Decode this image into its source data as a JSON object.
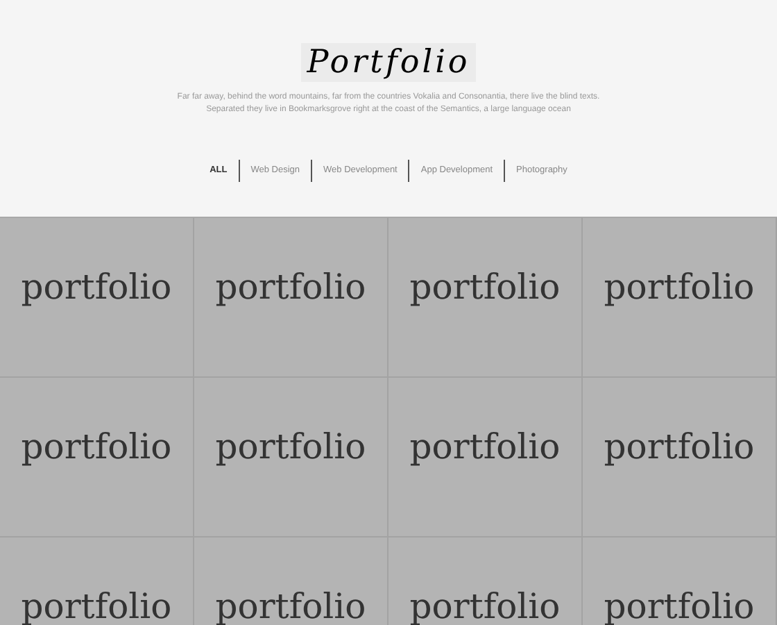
{
  "header": {
    "title": "Portfolio",
    "description": "Far far away, behind the word mountains, far from the countries Vokalia and Consonantia, there live the blind texts. Separated they live in Bookmarksgrove right at the coast of the Semantics, a large language ocean"
  },
  "filters": [
    {
      "label": "ALL",
      "selected": true
    },
    {
      "label": "Web Design",
      "selected": false
    },
    {
      "label": "Web Development",
      "selected": false
    },
    {
      "label": "App Development",
      "selected": false
    },
    {
      "label": "Photography",
      "selected": false
    }
  ],
  "tiles": [
    {
      "label": "portfolio"
    },
    {
      "label": "portfolio"
    },
    {
      "label": "portfolio"
    },
    {
      "label": "portfolio"
    },
    {
      "label": "portfolio"
    },
    {
      "label": "portfolio"
    },
    {
      "label": "portfolio"
    },
    {
      "label": "portfolio"
    },
    {
      "label": "portfolio"
    },
    {
      "label": "portfolio"
    },
    {
      "label": "portfolio"
    },
    {
      "label": "portfolio"
    }
  ]
}
